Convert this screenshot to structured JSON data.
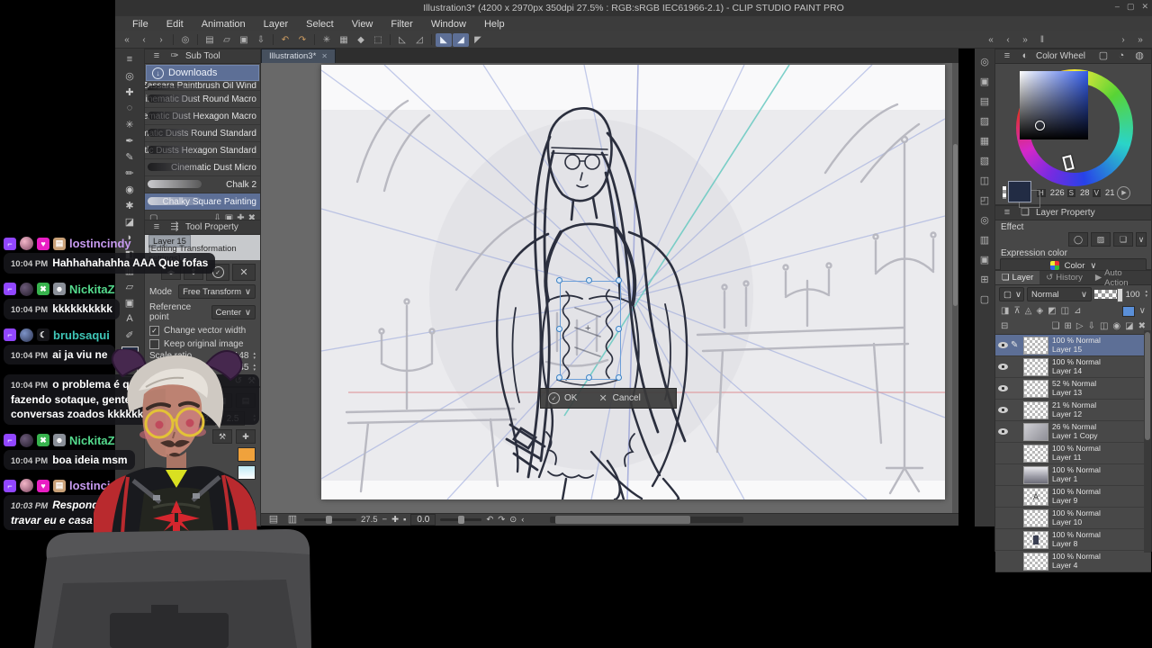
{
  "window": {
    "title": "Illustration3* (4200 x 2970px 350dpi 27.5% : RGB:sRGB IEC61966-2.1)  - CLIP STUDIO PAINT PRO",
    "menu": [
      "File",
      "Edit",
      "Animation",
      "Layer",
      "Select",
      "View",
      "Filter",
      "Window",
      "Help"
    ],
    "tab_title": "Illustration3*",
    "controls": {
      "minimize": "–",
      "maximize": "▢",
      "close": "✕"
    }
  },
  "subtool": {
    "header": "Sub Tool",
    "group": "Downloads",
    "items": [
      "Zassara Paintbrush Oil Wind",
      "Cinematic Dust Round Macro",
      "Cinematic Dust Hexagon Macro",
      "Cinematic Dusts Round Standard",
      "Cinematic Dusts Hexagon Standard",
      "Cinematic Dust Micro",
      "Chalk 2",
      "Chalky Square Painting"
    ]
  },
  "tool_property": {
    "header": "Tool Property",
    "layer_badge": "Layer 15",
    "status": "[Editing Transformation settings]",
    "mode_label": "Mode",
    "mode_value": "Free Transform",
    "ref_label": "Reference point",
    "ref_value": "Center",
    "check1": "Change vector width",
    "check2": "Keep original image",
    "scale_label": "Scale ratio",
    "w_label": "W",
    "w_value": "48",
    "h_label": "H",
    "h_value": "45"
  },
  "brush_panel": {
    "size1": "2",
    "size2": "2.5"
  },
  "canvas": {
    "ok": "OK",
    "cancel": "Cancel",
    "zoom": "27.5",
    "rotation": "0.0"
  },
  "color_wheel": {
    "header": "Color Wheel",
    "h_label": "H",
    "h": "226",
    "s_label": "S",
    "s": "28",
    "v_label": "V",
    "v": "21",
    "current_color": "#222c44"
  },
  "layer_property": {
    "header": "Layer Property",
    "effect_label": "Effect",
    "expression_label": "Expression color",
    "expression_value": "Color"
  },
  "layer_panel": {
    "tabs": [
      "Layer",
      "History",
      "Auto Action"
    ],
    "blend_mode": "Normal",
    "opacity": "100",
    "layers": [
      {
        "info": "100 % Normal",
        "name": "Layer 15"
      },
      {
        "info": "100 % Normal",
        "name": "Layer 14"
      },
      {
        "info": "52 % Normal",
        "name": "Layer 13"
      },
      {
        "info": "21 % Normal",
        "name": "Layer 12"
      },
      {
        "info": "26 % Normal",
        "name": "Layer 1 Copy"
      },
      {
        "info": "100 % Normal",
        "name": "Layer 11"
      },
      {
        "info": "100 % Normal",
        "name": "Layer 1"
      },
      {
        "info": "100 % Normal",
        "name": "Layer 9",
        "thumb_label": "A"
      },
      {
        "info": "100 % Normal",
        "name": "Layer 10"
      },
      {
        "info": "100 % Normal",
        "name": "Layer 8"
      },
      {
        "info": "100 % Normal",
        "name": "Layer 4"
      }
    ]
  },
  "chat": {
    "messages": [
      {
        "user": "lostincindy",
        "color": "#c79af0",
        "time": "10:04 PM",
        "text": "Hahhahahahha AAA Que fofas"
      },
      {
        "user": "NickitaZ",
        "color": "#54d98c",
        "time": "10:04 PM",
        "text": "kkkkkkkkkk"
      },
      {
        "user": "brubsaqui",
        "color": "#3fc6b7",
        "time": "10:04 PM",
        "text": "ai ja viu ne"
      },
      {
        "user": "brubsaqui",
        "color": "#3fc6b7",
        "time": "10:04 PM",
        "text": "o problema é q a gente a brincar fazendo sotaque, gente vai falar sério sai conversas zoados kkkkkkk"
      },
      {
        "user": "NickitaZ",
        "color": "#54d98c",
        "time": "10:04 PM",
        "text": "boa ideia msm"
      },
      {
        "user": "lostincindy",
        "color": "#c79af0",
        "time": "10:03 PM",
        "text": "Respondendo isso de travar eu e casa se vazar- No"
      }
    ]
  },
  "colors": {
    "accent_selection": "#5d6f96",
    "twitch_purple": "#9146ff"
  }
}
